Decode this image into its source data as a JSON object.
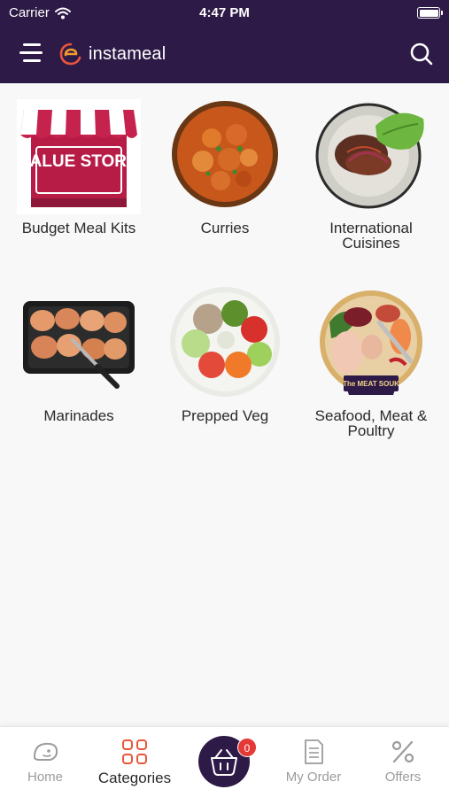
{
  "status_bar": {
    "carrier": "Carrier",
    "time": "4:47 PM"
  },
  "header": {
    "brand": "instameal",
    "menu_icon": "hamburger-menu-icon",
    "search_icon": "search-icon"
  },
  "categories": [
    {
      "label": "Budget Meal Kits",
      "image": "value-store-image",
      "image_text": "VALUE STORE"
    },
    {
      "label": "Curries",
      "image": "curry-bowl-image"
    },
    {
      "label": "International Cuisines",
      "image": "international-plate-image"
    },
    {
      "label": "Marinades",
      "image": "marinade-tray-image"
    },
    {
      "label": "Prepped Veg",
      "image": "prepped-veg-bowl-image"
    },
    {
      "label": "Seafood, Meat & Poultry",
      "image": "meat-souk-image",
      "image_text": "The MEAT SOUK"
    }
  ],
  "tab_bar": {
    "tabs": [
      {
        "label": "Home",
        "icon": "home-icon",
        "active": false
      },
      {
        "label": "Categories",
        "icon": "categories-grid-icon",
        "active": true
      },
      {
        "label": "My Order",
        "icon": "receipt-icon",
        "active": false
      },
      {
        "label": "Offers",
        "icon": "percent-icon",
        "active": false
      }
    ],
    "cart": {
      "icon": "basket-icon",
      "count": "0"
    }
  },
  "colors": {
    "header_bg": "#2e1a47",
    "accent": "#e8573b",
    "badge": "#e53935",
    "background": "#f8f8f8"
  }
}
